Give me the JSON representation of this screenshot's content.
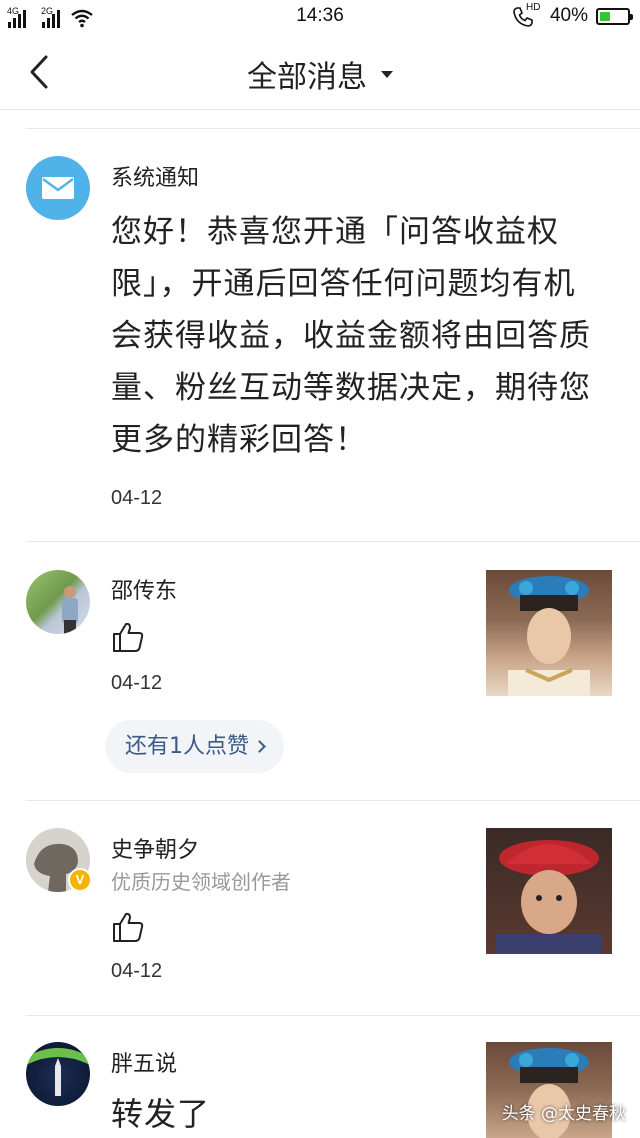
{
  "status_bar": {
    "signal1_label": "4G",
    "signal2_label": "2G",
    "time": "14:36",
    "hd_label": "HD",
    "battery_text": "40%",
    "battery_level": 0.4
  },
  "header": {
    "title": "全部消息"
  },
  "messages": [
    {
      "sender": "系统通知",
      "body": "您好！恭喜您开通「问答收益权限」，开通后回答任何问题均有机会获得收益，收益金额将由回答质量、粉丝互动等数据决定，期待您更多的精彩回答！",
      "date": "04-12",
      "avatar_icon": "mail-icon"
    },
    {
      "sender": "邵传东",
      "date": "04-12",
      "action_icon": "thumbs-up-icon",
      "more_likes": "还有1人点赞"
    },
    {
      "sender": "史争朝夕",
      "subtitle": "优质历史领域创作者",
      "badge": "V",
      "date": "04-12",
      "action_icon": "thumbs-up-icon"
    },
    {
      "sender": "胖五说",
      "body": "转发了"
    }
  ],
  "watermark": "头条 @太史春秋",
  "colors": {
    "mail_avatar": "#4fb3ea",
    "link_text": "#3b5a85",
    "battery_fill": "#33c43a",
    "badge": "#f5b400"
  }
}
